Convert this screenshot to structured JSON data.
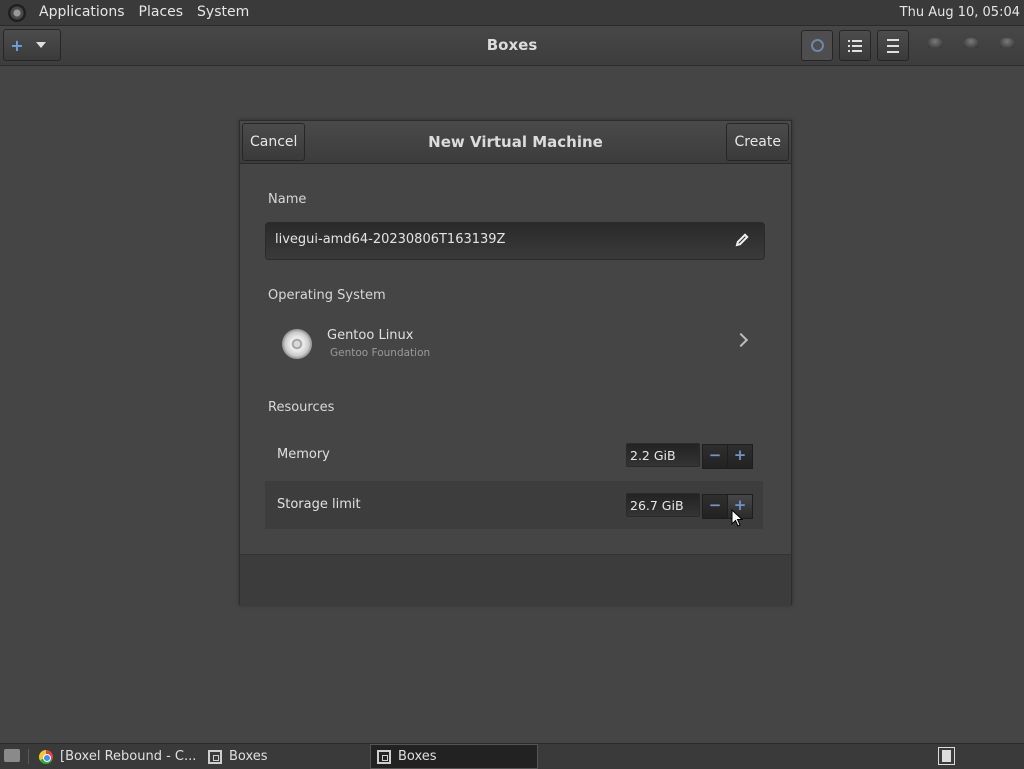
{
  "top_panel": {
    "menus": [
      "Applications",
      "Places",
      "System"
    ],
    "clock": "Thu Aug 10, 05:04"
  },
  "headerbar": {
    "title": "Boxes",
    "new_button_icon": "plus-icon",
    "buttons": [
      "search-icon",
      "list-view-icon",
      "hamburger-menu-icon"
    ]
  },
  "dialog": {
    "title": "New Virtual Machine",
    "cancel_label": "Cancel",
    "create_label": "Create",
    "name_label": "Name",
    "name_value": "livegui-amd64-20230806T163139Z",
    "os_label": "Operating System",
    "os_name": "Gentoo Linux",
    "os_vendor": "Gentoo Foundation",
    "resources_label": "Resources",
    "resources": [
      {
        "label": "Memory",
        "value": "2.2 GiB"
      },
      {
        "label": "Storage limit",
        "value": "26.7 GiB"
      }
    ]
  },
  "taskbar": {
    "items": [
      {
        "label": "[Boxel Rebound - C...",
        "icon": "chrome-icon"
      },
      {
        "label": "Boxes",
        "icon": "boxes-icon"
      },
      {
        "label": "Boxes",
        "icon": "boxes-icon"
      }
    ]
  },
  "colors": {
    "accent": "#6f95c9",
    "background": "#454545"
  }
}
